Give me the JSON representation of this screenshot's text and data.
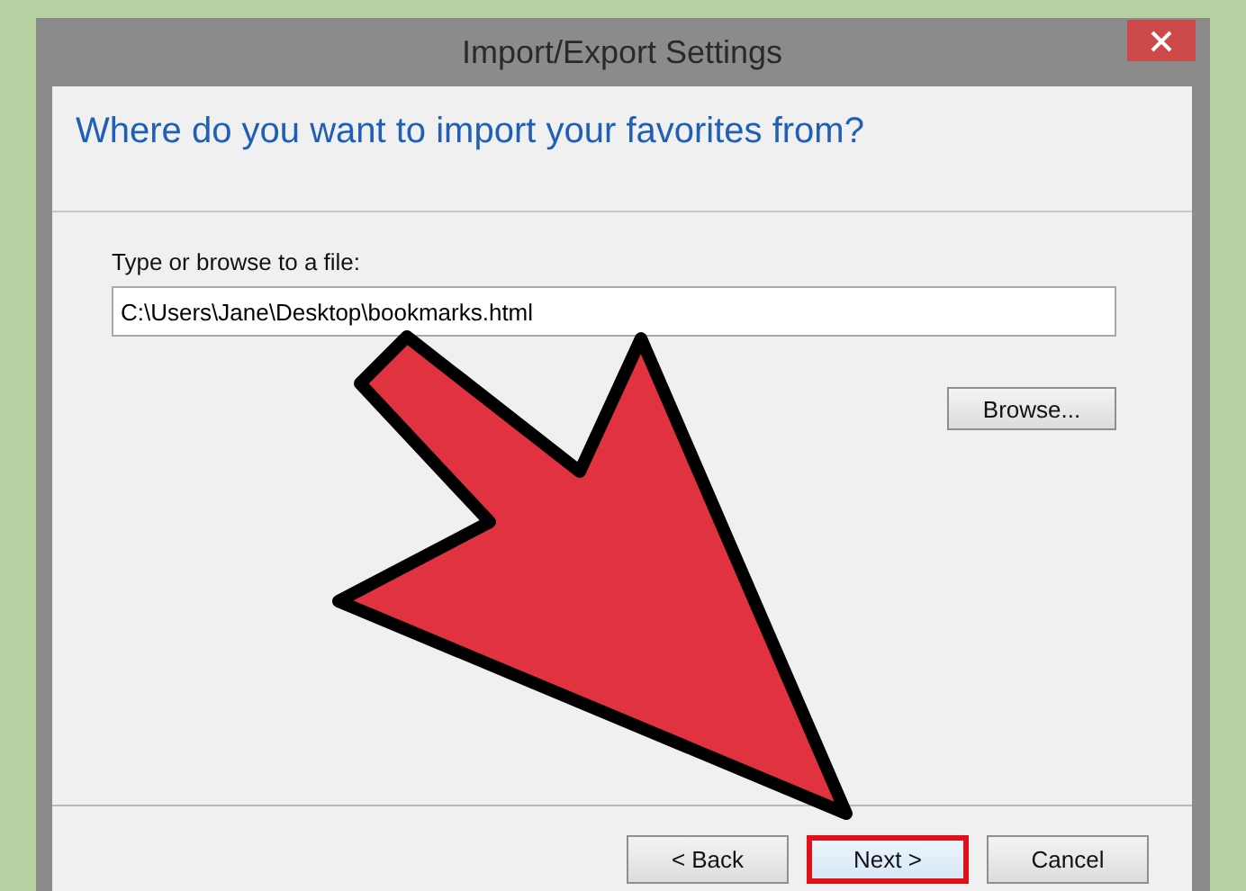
{
  "window": {
    "title": "Import/Export Settings"
  },
  "heading": "Where do you want to import your favorites from?",
  "file": {
    "label": "Type or browse to a file:",
    "value": "C:\\Users\\Jane\\Desktop\\bookmarks.html"
  },
  "browse_button": "Browse...",
  "annotation": {
    "kind": "arrow"
  },
  "buttons": [
    {
      "label": "< Back",
      "highlighted": false
    },
    {
      "label": "Next >",
      "highlighted": true
    },
    {
      "label": "Cancel",
      "highlighted": false
    }
  ]
}
